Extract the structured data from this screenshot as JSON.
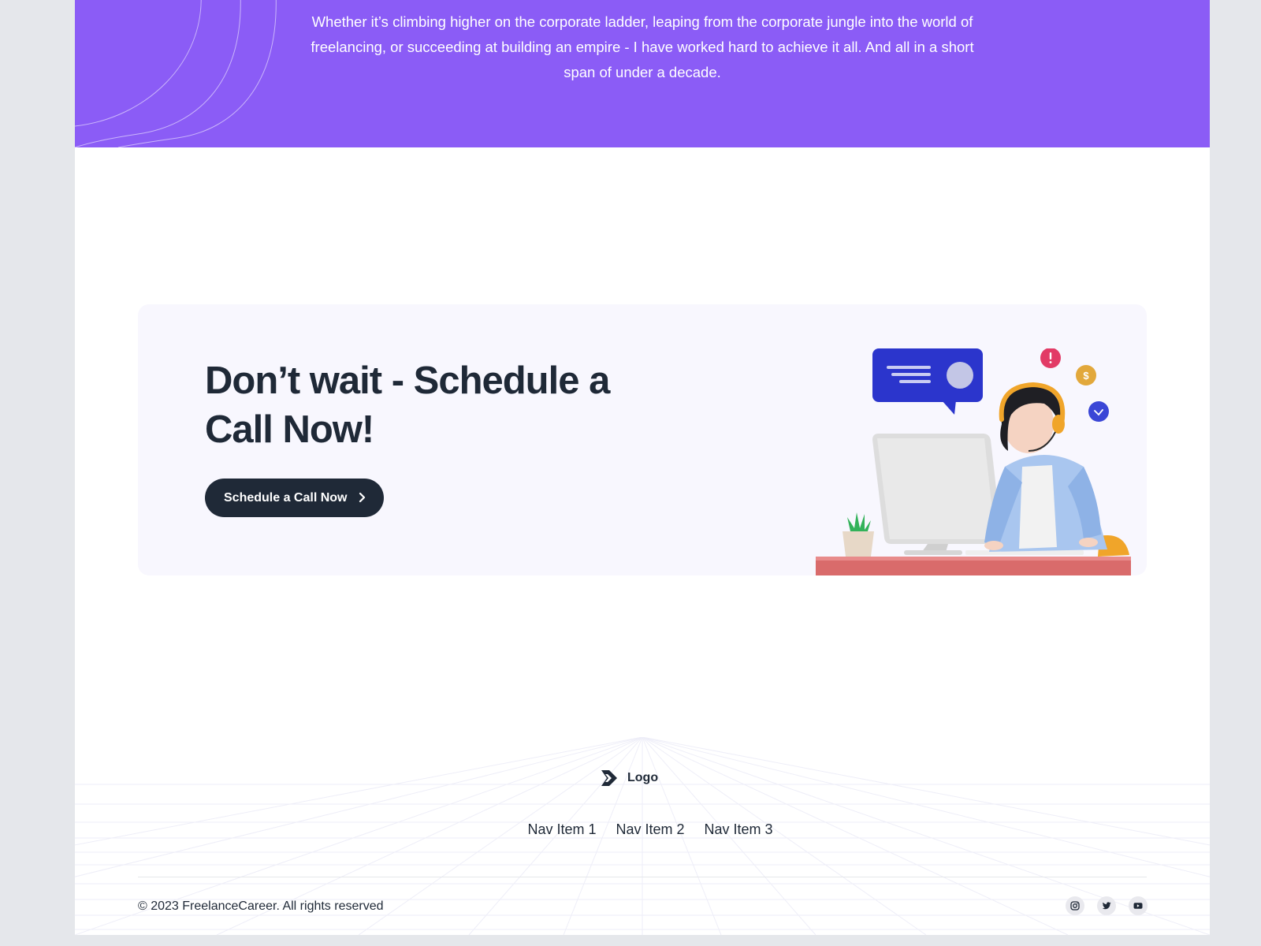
{
  "hero": {
    "text": "Whether it’s climbing higher on the corporate ladder, leaping from the corporate jungle into the world of freelancing, or succeeding at building an empire - I have worked hard to achieve it all. And all in a short span of under a decade."
  },
  "cta": {
    "title": "Don’t wait - Schedule a Call Now!",
    "button_label": "Schedule a Call Now",
    "button_icon": "chevron-right-icon",
    "illustration": "support-agent-at-computer-illustration"
  },
  "footer": {
    "logo_label": "Logo",
    "logo_icon": "double-chevron-logo-icon",
    "nav": [
      "Nav Item 1",
      "Nav Item 2",
      "Nav Item 3"
    ],
    "copyright": "© 2023 FreelanceCareer. All rights reserved",
    "socials": [
      "instagram-icon",
      "twitter-icon",
      "youtube-icon"
    ]
  },
  "colors": {
    "hero_bg": "#8b5cf6",
    "text_dark": "#1f2937",
    "card_bg": "#f8f7fe",
    "page_bg": "#e5e7eb"
  }
}
